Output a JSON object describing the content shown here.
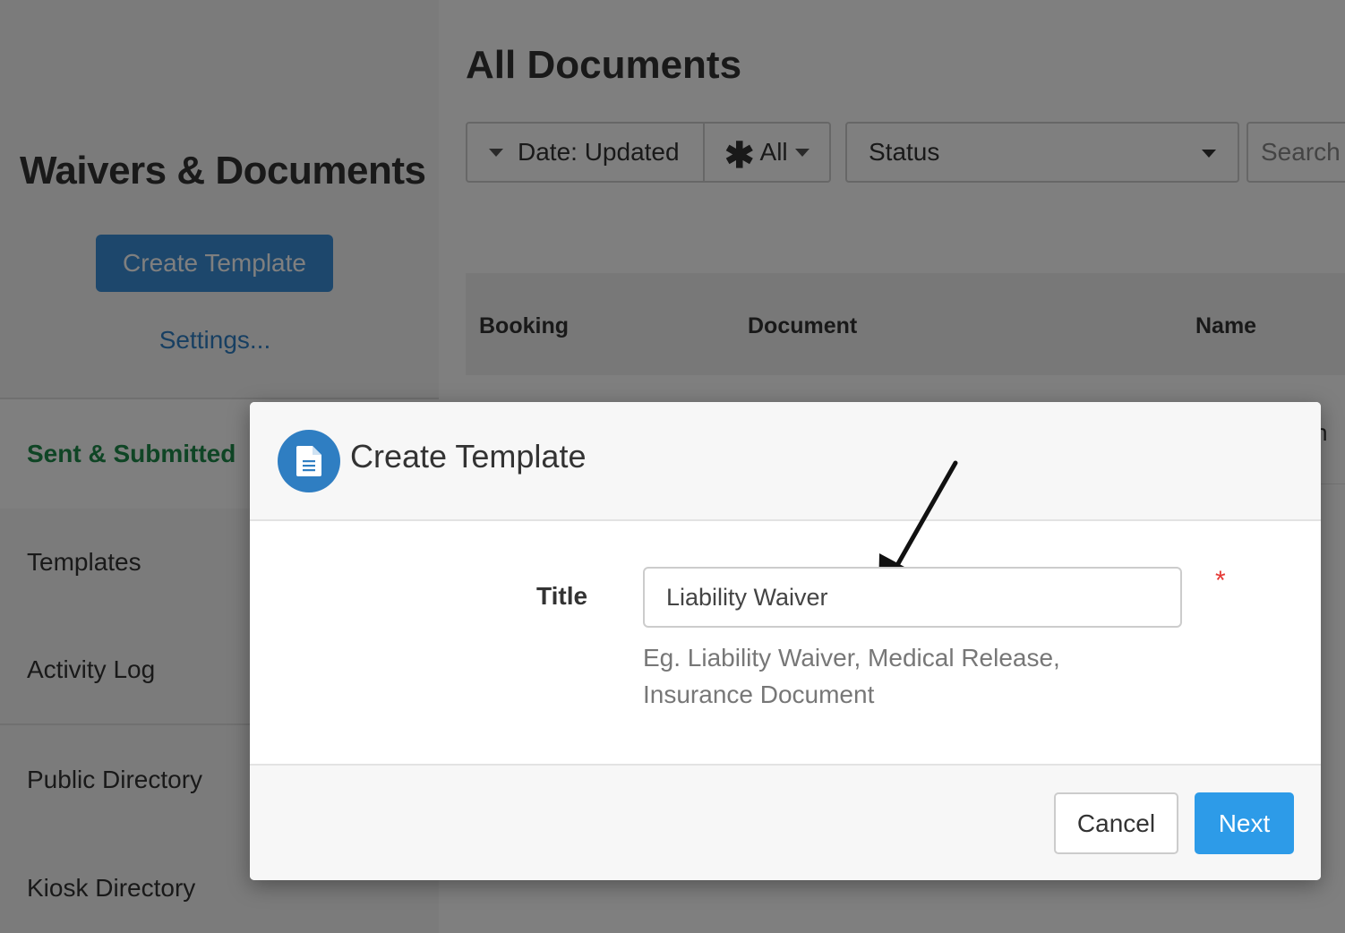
{
  "sidebar": {
    "title": "Waivers & Documents",
    "create_button": "Create Template",
    "settings_link": "Settings...",
    "nav_items": [
      {
        "label": "Sent & Submitted",
        "active": true
      },
      {
        "label": "Templates",
        "active": false
      },
      {
        "label": "Activity Log",
        "active": false
      },
      {
        "label": "Public Directory",
        "active": false
      },
      {
        "label": "Kiosk Directory",
        "active": false
      }
    ]
  },
  "main": {
    "title": "All Documents",
    "filters": {
      "date_label": "Date: Updated",
      "all_label": "All",
      "status_label": "Status",
      "search_placeholder": "Search"
    },
    "table": {
      "columns": [
        "Booking",
        "Document",
        "Name"
      ],
      "peek_text": "n"
    }
  },
  "modal": {
    "title": "Create Template",
    "icon": "document-icon",
    "field_label": "Title",
    "field_value": "Liability Waiver",
    "required_marker": "*",
    "help_text_line1": "Eg. Liability Waiver, Medical Release,",
    "help_text_line2": "Insurance Document",
    "cancel_label": "Cancel",
    "next_label": "Next"
  },
  "colors": {
    "primary": "#2d9be8",
    "active_nav": "#1e8a4a",
    "required": "#e53935",
    "icon_bg": "#2f7ec2"
  }
}
